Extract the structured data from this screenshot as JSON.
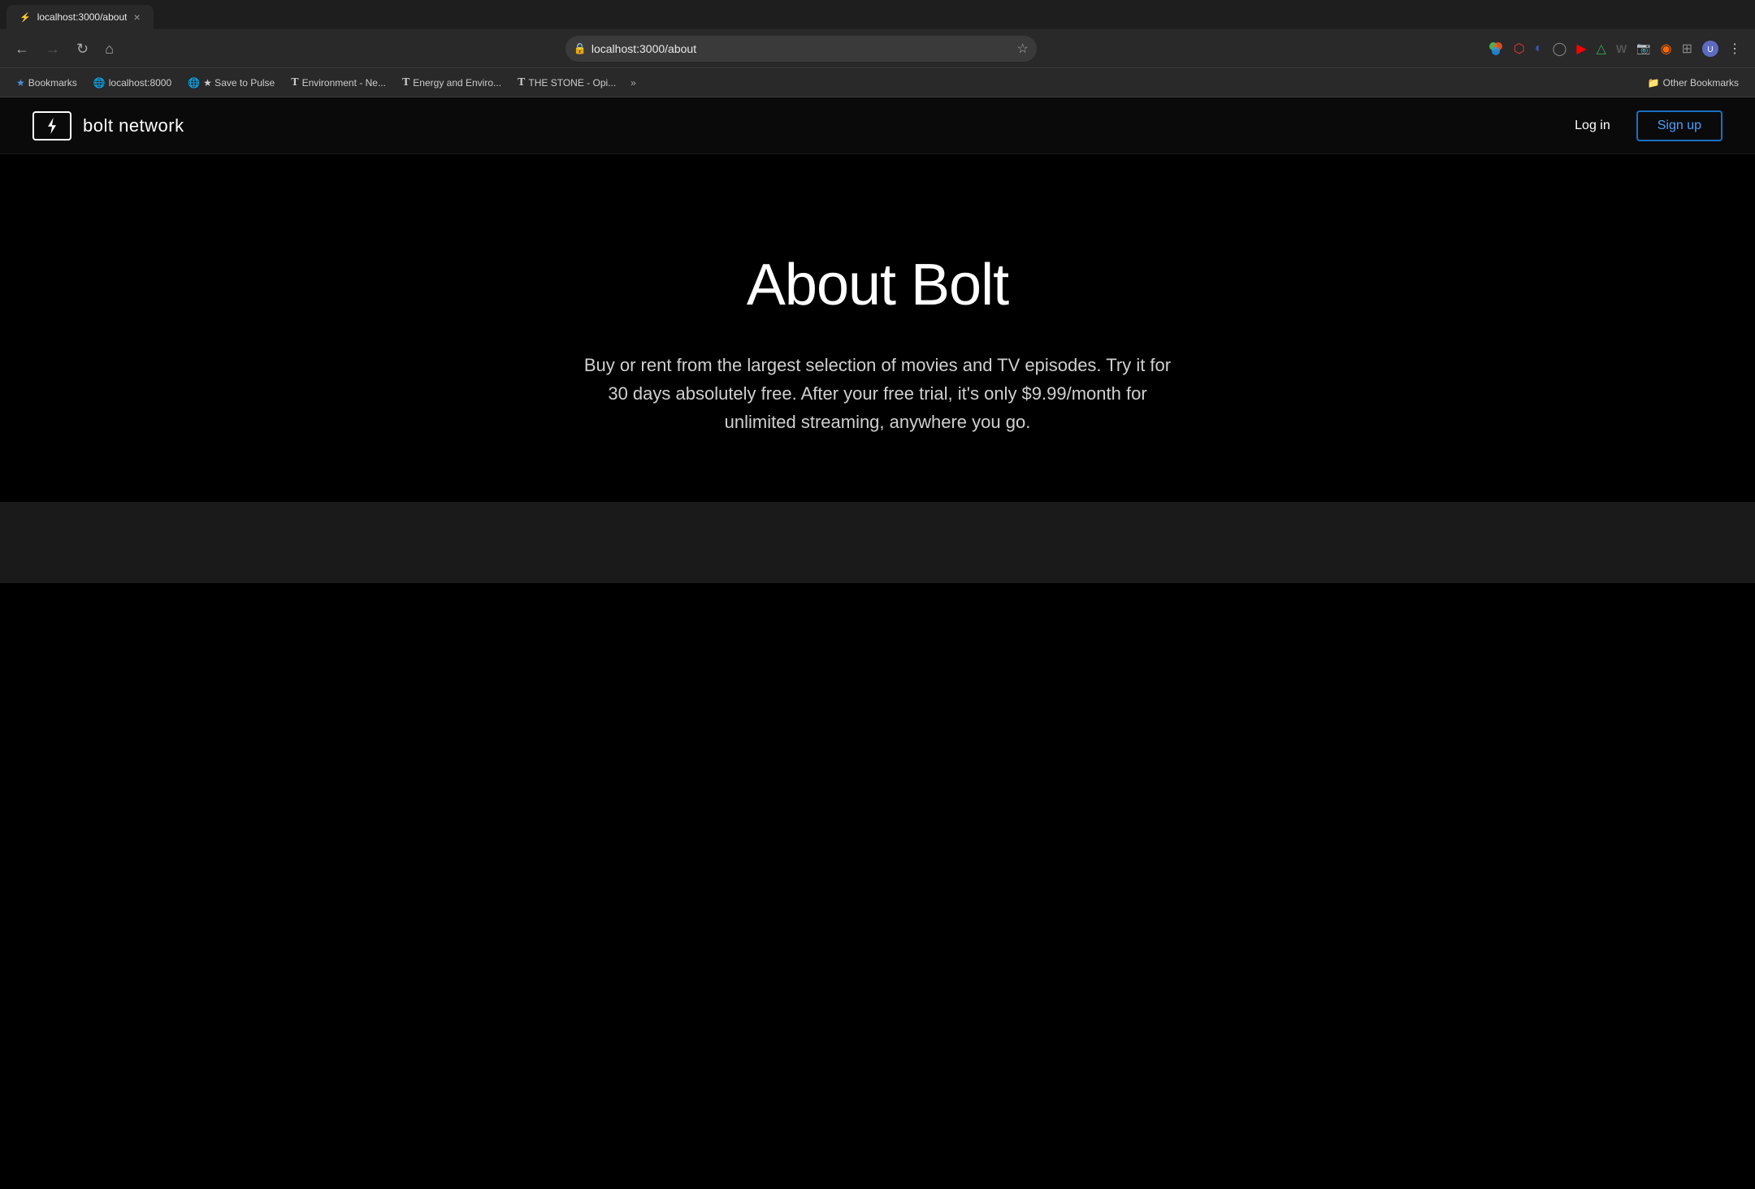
{
  "browser": {
    "tab": {
      "favicon": "⚡",
      "title": "localhost:3000/about"
    },
    "url": "localhost:3000/about",
    "nav": {
      "back_disabled": false,
      "forward_disabled": true
    }
  },
  "bookmarks_bar": {
    "items": [
      {
        "id": "bookmarks",
        "icon": "★",
        "label": "Bookmarks",
        "starred": false
      },
      {
        "id": "localhost8000",
        "icon": "🌐",
        "label": "localhost:8000"
      },
      {
        "id": "save-to-pulse",
        "icon": "🌐",
        "label": "★ Save to Pulse"
      },
      {
        "id": "environment-ne",
        "icon": "📰",
        "label": "Environment - Ne..."
      },
      {
        "id": "energy-enviro",
        "icon": "📰",
        "label": "Energy and Enviro..."
      },
      {
        "id": "the-stone-opi",
        "icon": "📰",
        "label": "THE STONE - Opi..."
      }
    ],
    "other_bookmarks_label": "Other Bookmarks"
  },
  "site": {
    "logo_text": "bolt network",
    "nav": {
      "login_label": "Log in",
      "signup_label": "Sign up"
    },
    "hero": {
      "title": "About Bolt",
      "subtitle": "Buy or rent from the largest selection of movies and TV episodes. Try it for 30 days absolutely free. After your free trial, it's only $9.99/month for unlimited streaming, anywhere you go."
    }
  },
  "icons": {
    "back": "←",
    "forward": "→",
    "reload": "↻",
    "home": "⌂",
    "security": "🔒",
    "bookmark_star": "☆",
    "more_vert": "⋮",
    "folder": "📁"
  }
}
